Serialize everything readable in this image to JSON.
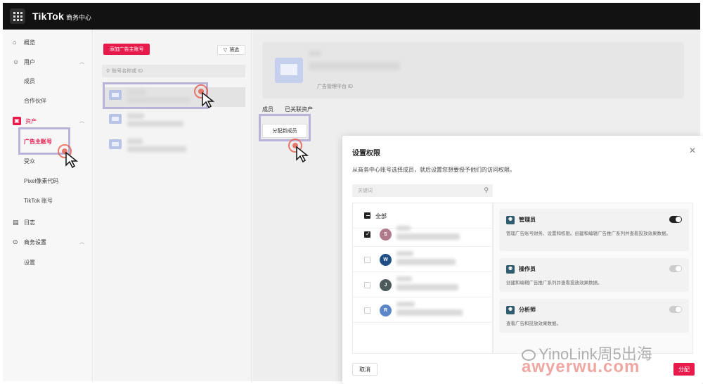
{
  "topbar": {
    "brand": "TikTok",
    "brand_sub": "商务中心"
  },
  "sidebar": {
    "overview": "概览",
    "users": "用户",
    "members": "成员",
    "partners": "合作伙伴",
    "assets": "资产",
    "advertiser_accounts": "广告主账号",
    "audiences": "受众",
    "pixel_code": "Pixel像素代码",
    "tiktok_accounts": "TikTok 账号",
    "logs": "日志",
    "business_settings": "商务设置",
    "settings": "设置"
  },
  "middle": {
    "add_advertiser": "添加广告主账号",
    "filter": "筛选",
    "search_placeholder": "账号名称或 ID"
  },
  "main": {
    "platform_label": "广告管理平台 ID",
    "tab_members": "成员",
    "tab_linked_assets": "已关联资产",
    "assign_member": "分配新成员"
  },
  "modal": {
    "title": "设置权限",
    "description": "从商务中心账号选择成员，就后设置您想要授予他们的访问权限。",
    "keyword_placeholder": "关键词",
    "select_all": "全部",
    "members": [
      {
        "initial": "S",
        "checked": true,
        "color": "#b07a8a"
      },
      {
        "initial": "W",
        "checked": false,
        "color": "#1f4f86"
      },
      {
        "initial": "J",
        "checked": false,
        "color": "#4d5a5c"
      },
      {
        "initial": "R",
        "checked": false,
        "color": "#5a86c9"
      }
    ],
    "roles": [
      {
        "name": "管理员",
        "desc": "管理广告账号财务、设置和权限。创建和编辑广告推广系列并查看投放效果数据。",
        "enabled": true
      },
      {
        "name": "操作员",
        "desc": "创建和编辑广告推广系列并查看投放效果数据。",
        "enabled": false
      },
      {
        "name": "分析师",
        "desc": "查看广告和投放效果数据。",
        "enabled": false
      }
    ],
    "cancel": "取消",
    "confirm": "分配"
  },
  "watermark": {
    "line1": "YinoLink周5出海",
    "line2": "awyerwu.com"
  },
  "colors": {
    "accent": "#e8194b",
    "topbar": "#121212",
    "highlight": "#b9b3da"
  }
}
